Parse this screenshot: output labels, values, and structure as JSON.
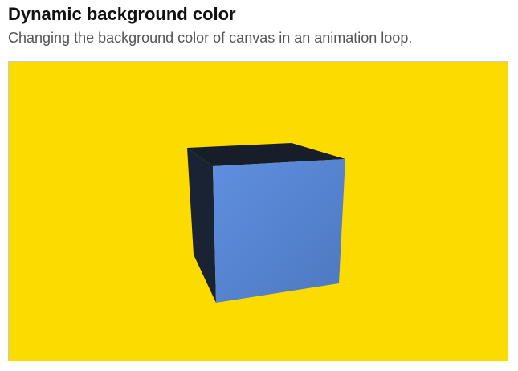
{
  "header": {
    "title": "Dynamic background color",
    "subtitle": "Changing the background color of canvas in an animation loop."
  },
  "canvas": {
    "background_color": "#FCDB00",
    "cube": {
      "front_face_color": "#5F8FE0",
      "front_face_shade_color": "#4D78C0",
      "side_face_color": "#1A2333",
      "top_face_color": "#161E2A"
    }
  }
}
